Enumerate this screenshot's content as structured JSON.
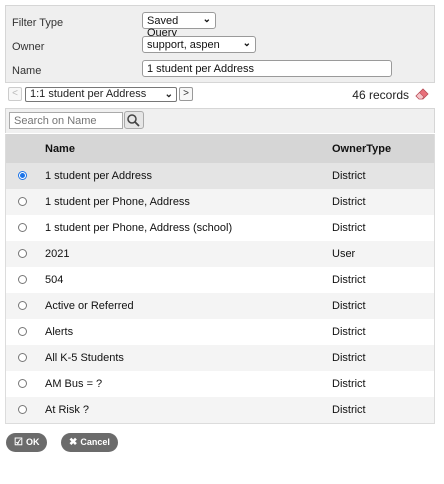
{
  "filter": {
    "filter_type_label": "Filter Type",
    "filter_type_value": "Saved Query",
    "owner_label": "Owner",
    "owner_value": "support, aspen",
    "name_label": "Name",
    "name_value": "1 student per Address"
  },
  "nav": {
    "prev": "<",
    "next": ">",
    "query_select_value": "1:1 student per Address",
    "record_count": "46 records"
  },
  "search": {
    "placeholder": "Search on Name"
  },
  "table": {
    "headers": {
      "name": "Name",
      "owner_type": "OwnerType"
    },
    "rows": [
      {
        "name": "1 student per Address",
        "owner_type": "District",
        "selected": true
      },
      {
        "name": "1 student per Phone, Address",
        "owner_type": "District",
        "selected": false
      },
      {
        "name": "1 student per Phone, Address (school)",
        "owner_type": "District",
        "selected": false
      },
      {
        "name": "2021",
        "owner_type": "User",
        "selected": false
      },
      {
        "name": "504",
        "owner_type": "District",
        "selected": false
      },
      {
        "name": "Active or Referred",
        "owner_type": "District",
        "selected": false
      },
      {
        "name": "Alerts",
        "owner_type": "District",
        "selected": false
      },
      {
        "name": "All K-5 Students",
        "owner_type": "District",
        "selected": false
      },
      {
        "name": "AM Bus = ?",
        "owner_type": "District",
        "selected": false
      },
      {
        "name": "At Risk ?",
        "owner_type": "District",
        "selected": false
      }
    ]
  },
  "buttons": {
    "ok": "OK",
    "cancel": "Cancel"
  },
  "icons": {
    "eraser": "eraser-icon",
    "search": "search-icon",
    "ok": "check-icon",
    "cancel": "x-icon"
  },
  "colors": {
    "radio_selected": "#1a73e8",
    "button_bg": "#6b6b6b",
    "eraser": "#e8707a"
  }
}
